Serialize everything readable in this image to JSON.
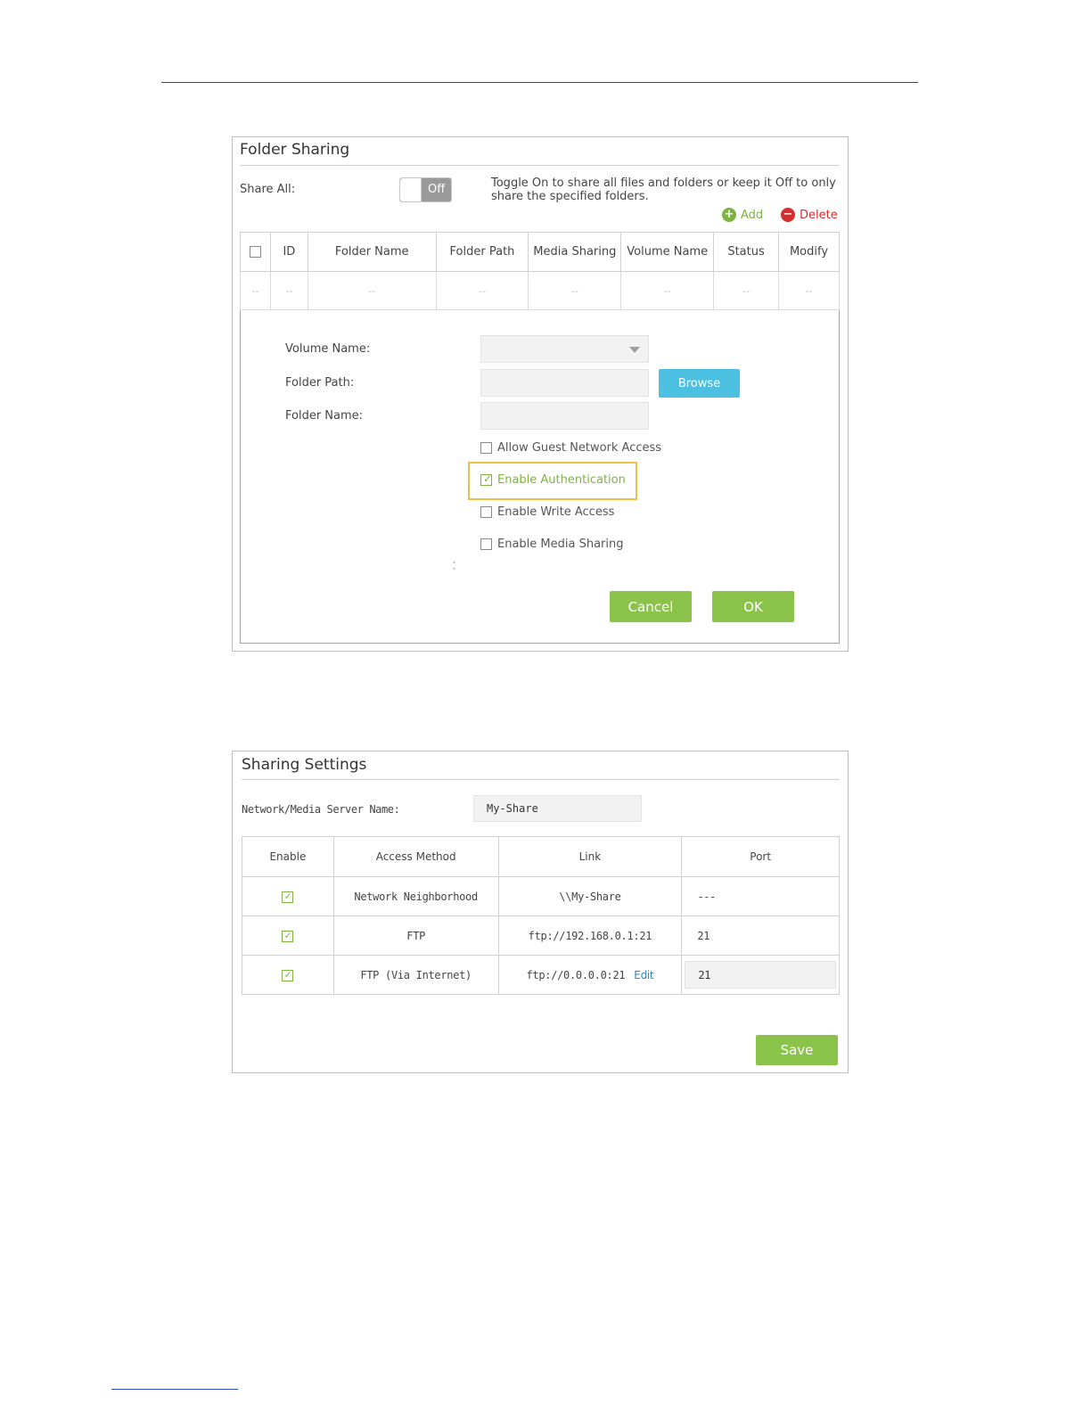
{
  "folder_sharing": {
    "title": "Folder Sharing",
    "share_all_label": "Share All:",
    "toggle_state": "Off",
    "description": "Toggle On to share all files and folders or keep it Off to only share the specified folders.",
    "add_label": "Add",
    "delete_label": "Delete",
    "table": {
      "headers": [
        "ID",
        "Folder Name",
        "Folder Path",
        "Media Sharing",
        "Volume Name",
        "Status",
        "Modify"
      ],
      "row": [
        "--",
        "--",
        "--",
        "--",
        "--",
        "--",
        "--",
        "--"
      ]
    },
    "form": {
      "volume_name_label": "Volume Name:",
      "folder_path_label": "Folder Path:",
      "folder_name_label": "Folder Name:",
      "browse_label": "Browse",
      "options": {
        "guest": "Allow Guest Network Access",
        "auth": "Enable Authentication",
        "write": "Enable Write Access",
        "media": "Enable Media Sharing"
      },
      "cancel_label": "Cancel",
      "ok_label": "OK"
    }
  },
  "sharing_settings": {
    "title": "Sharing Settings",
    "server_name_label": "Network/Media Server Name:",
    "server_name_value": "My-Share",
    "headers": [
      "Enable",
      "Access Method",
      "Link",
      "Port"
    ],
    "rows": [
      {
        "method": "Network Neighborhood",
        "link": "\\\\My-Share",
        "port": "---"
      },
      {
        "method": "FTP",
        "link": "ftp://192.168.0.1:21",
        "port": "21"
      },
      {
        "method": "FTP (Via Internet)",
        "link": "ftp://0.0.0.0:21",
        "edit": "Edit",
        "port": "21"
      }
    ],
    "save_label": "Save"
  },
  "colors": {
    "accent_green": "#8bc34a",
    "browse_blue": "#4bc0e0",
    "delete_red": "#d32f2f",
    "highlight_yellow": "#f0c040"
  }
}
